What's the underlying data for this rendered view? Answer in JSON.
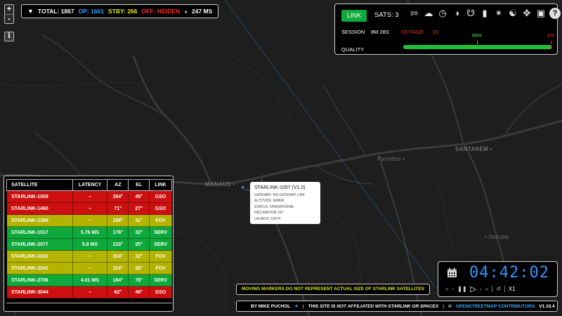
{
  "map": {
    "cities": [
      "MANAUS",
      "SANTARÉM",
      "Parintins",
      "Itaituba"
    ],
    "zoom_in": "+",
    "zoom_out": "-",
    "info": "i"
  },
  "stats": {
    "total": "TOTAL: 1867",
    "op": "OP: 1601",
    "stby": "STBY: 266",
    "off": "OFF: HIDDEN",
    "ms": "247 MS"
  },
  "connection": {
    "link_label": "LINK",
    "sats": "SATS: 3",
    "icons": [
      "logout-icon",
      "weather-cloud-icon",
      "clock-icon",
      "starlink-icon",
      "satellite-icon",
      "signal-bars-icon",
      "spiderweb-icon",
      "network-icon",
      "move-icon",
      "grid-icon",
      "help-icon"
    ],
    "session_label": "SESSION",
    "session_value": "8M 28S",
    "outage_label": "OUTAGE",
    "outage_value": "1S",
    "quality_label": "QUALITY",
    "quality_good": "99%",
    "quality_bad": "1%",
    "quality_fraction": 0.99
  },
  "table": {
    "headers": [
      "SATELLITE",
      "LATENCY",
      "AZ",
      "EL",
      "LINK"
    ],
    "rows": [
      {
        "status": "gso",
        "cells": [
          "STARLINK-1059",
          "–",
          "354°",
          "45°",
          "GSO"
        ]
      },
      {
        "status": "gso",
        "cells": [
          "STARLINK-1460",
          "–",
          "71°",
          "27°",
          "GSO"
        ]
      },
      {
        "status": "fov",
        "cells": [
          "STARLINK-1399",
          "–",
          "258°",
          "41°",
          "FOV"
        ]
      },
      {
        "status": "serv",
        "cells": [
          "STARLINK-1517",
          "5.76 MS",
          "176°",
          "32°",
          "SERV"
        ]
      },
      {
        "status": "serv",
        "cells": [
          "STARLINK-2077",
          "5.8 MS",
          "219°",
          "25°",
          "SERV"
        ]
      },
      {
        "status": "fov",
        "cells": [
          "STARLINK-2031",
          "–",
          "314°",
          "32°",
          "FOV"
        ]
      },
      {
        "status": "fov",
        "cells": [
          "STARLINK-2041",
          "–",
          "114°",
          "28°",
          "FOV"
        ]
      },
      {
        "status": "serv",
        "cells": [
          "STARLINK-2706",
          "4.01 MS",
          "184°",
          "76°",
          "SERV"
        ]
      },
      {
        "status": "gso",
        "cells": [
          "STARLINK-3044",
          "–",
          "62°",
          "46°",
          "GSO"
        ]
      }
    ]
  },
  "popup": {
    "title": "STARLINK-1057 (V1.0)",
    "lines": [
      "GATEWAY: NO GATEWAY LINK",
      "ALTITUDE: 549KM",
      "STATUS: OPERATIONAL",
      "INCLINATION: 53°",
      "LAUNCH: 19074"
    ]
  },
  "notice": "MOVING MARKERS DO NOT REPRESENT ACTUAL SIZE OF STARLINK SATELLITES",
  "footer": {
    "author": "BY MIKE PUCHOL",
    "disclaimer": "THIS SITE IS NOT AFFILIATED WITH STARLINK OR SPACEX",
    "copyright": "©",
    "osm": "OPENSTREETMAP CONTRIBUTORS",
    "version": "V1.10.4"
  },
  "clock": {
    "time": "04:42:02",
    "speed": "X1"
  },
  "colors": {
    "gso": "#cc1010",
    "fov": "#b3b300",
    "serv": "#0fa83b",
    "accent_blue": "#2e97ff"
  }
}
